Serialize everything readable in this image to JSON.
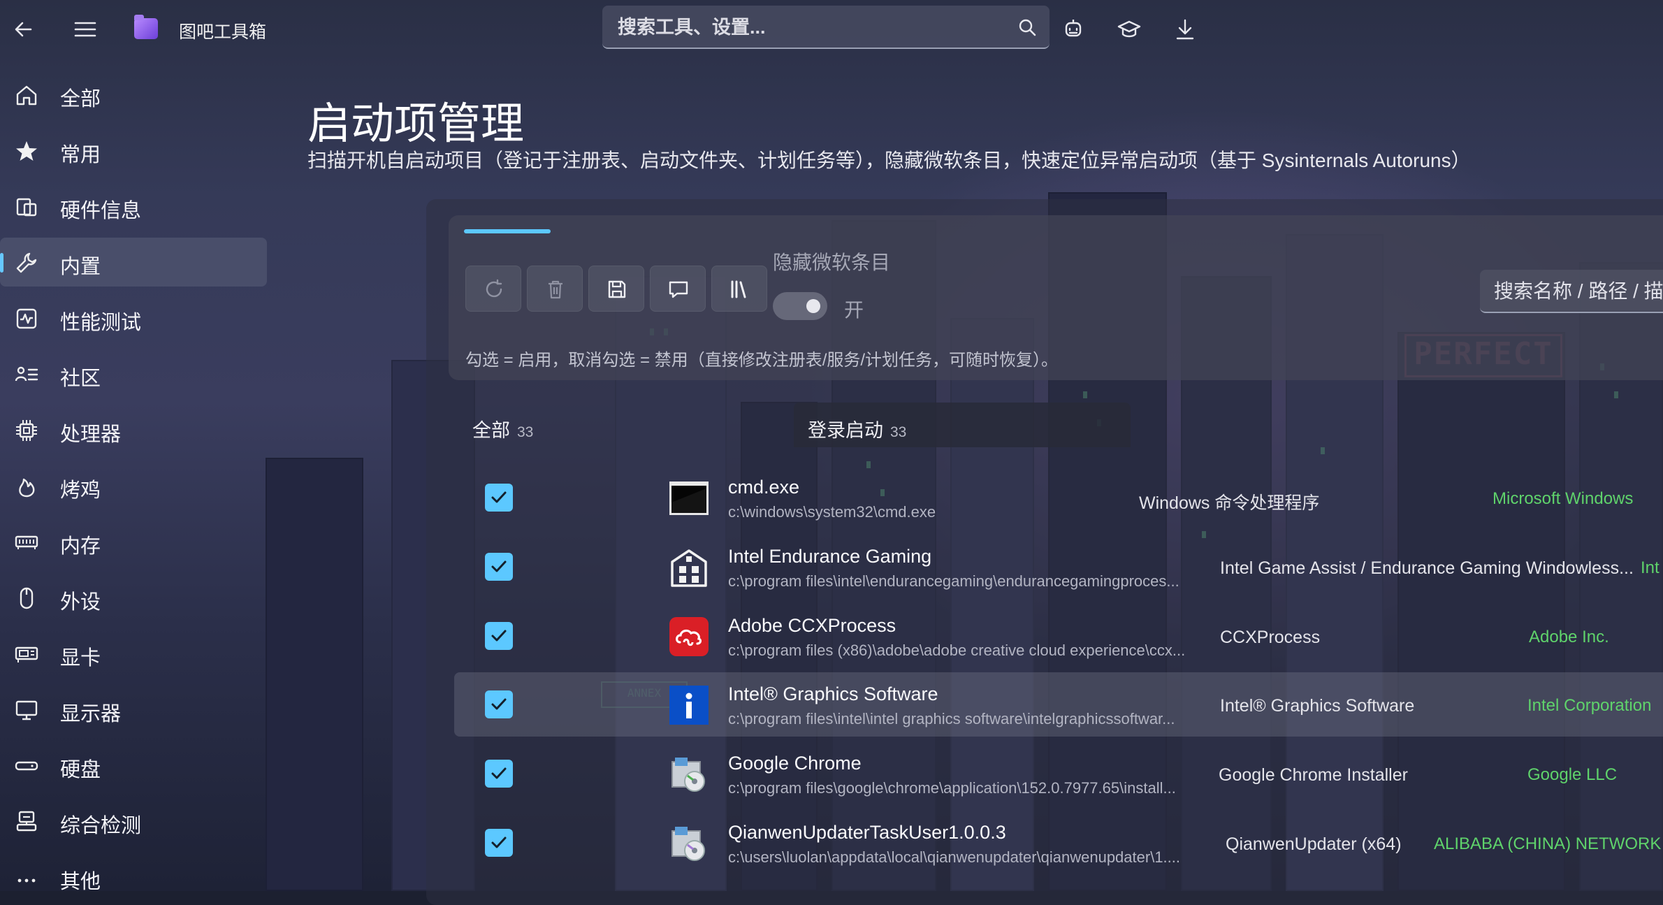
{
  "app": {
    "title": "图吧工具箱"
  },
  "search": {
    "placeholder": "搜索工具、设置..."
  },
  "sidebar": {
    "items": [
      {
        "label": "全部",
        "icon": "home-icon"
      },
      {
        "label": "常用",
        "icon": "star-icon"
      },
      {
        "label": "硬件信息",
        "icon": "hardware-info-icon"
      },
      {
        "label": "内置",
        "icon": "wrench-icon",
        "active": true
      },
      {
        "label": "性能测试",
        "icon": "pulse-icon"
      },
      {
        "label": "社区",
        "icon": "community-icon"
      },
      {
        "label": "处理器",
        "icon": "cpu-icon"
      },
      {
        "label": "烤鸡",
        "icon": "flame-icon"
      },
      {
        "label": "内存",
        "icon": "memory-icon"
      },
      {
        "label": "外设",
        "icon": "mouse-icon"
      },
      {
        "label": "显卡",
        "icon": "gpu-icon"
      },
      {
        "label": "显示器",
        "icon": "monitor-icon"
      },
      {
        "label": "硬盘",
        "icon": "disk-icon"
      },
      {
        "label": "综合检测",
        "icon": "diagnostics-icon"
      },
      {
        "label": "其他",
        "icon": "more-icon"
      }
    ]
  },
  "page": {
    "title": "启动项管理",
    "subtitle": "扫描开机自启动项目（登记于注册表、启动文件夹、计划任务等），隐藏微软条目，快速定位异常启动项（基于 Sysinternals Autoruns）"
  },
  "toolbar": {
    "toggle_label": "隐藏微软条目",
    "toggle_state": "开",
    "toggle_on": true,
    "search_placeholder": "搜索名称 / 路径 / 描述",
    "hint": "勾选 = 启用，取消勾选 = 禁用（直接修改注册表/服务/计划任务，可随时恢复）。"
  },
  "tabs": [
    {
      "label": "全部",
      "count": "33"
    },
    {
      "label": "登录启动",
      "count": "33"
    }
  ],
  "colors": {
    "accent": "#5cc8ff",
    "publisher": "#5fd36b"
  },
  "entries": [
    {
      "name": "cmd.exe",
      "path": "c:\\windows\\system32\\cmd.exe",
      "description": "Windows 命令处理程序",
      "publisher": "Microsoft Windows",
      "enabled": true,
      "icon": "cmd-icon"
    },
    {
      "name": "Intel Endurance Gaming",
      "path": "c:\\program files\\intel\\endurancegaming\\endurancegamingproces...",
      "description": "Intel Game Assist / Endurance Gaming Windowless...",
      "publisher": "Int",
      "enabled": true,
      "icon": "building-icon"
    },
    {
      "name": "Adobe CCXProcess",
      "path": "c:\\program files (x86)\\adobe\\adobe creative cloud experience\\ccx...",
      "description": "CCXProcess",
      "publisher": "Adobe Inc.",
      "enabled": true,
      "icon": "adobe-cc-icon"
    },
    {
      "name": "Intel® Graphics Software",
      "path": "c:\\program files\\intel\\intel graphics software\\intelgraphicssoftwar...",
      "description": "Intel® Graphics Software",
      "publisher": "Intel Corporation",
      "enabled": true,
      "icon": "intel-info-icon"
    },
    {
      "name": "Google Chrome",
      "path": "c:\\program files\\google\\chrome\\application\\152.0.7977.65\\install...",
      "description": "Google Chrome Installer",
      "publisher": "Google LLC",
      "enabled": true,
      "icon": "installer-icon"
    },
    {
      "name": "QianwenUpdaterTaskUser1.0.0.3",
      "path": "c:\\users\\luolan\\appdata\\local\\qianwenupdater\\qianwenupdater\\1....",
      "description": "QianwenUpdater (x64)",
      "publisher": "ALIBABA (CHINA) NETWORK TE",
      "enabled": true,
      "icon": "installer-icon"
    }
  ]
}
